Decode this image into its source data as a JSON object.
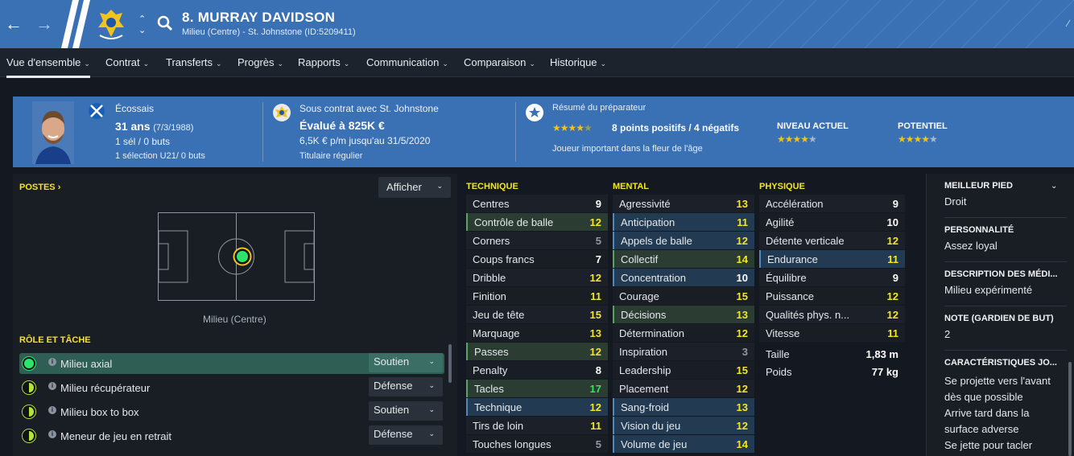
{
  "header": {
    "title": "8. MURRAY DAVIDSON",
    "subtitle": "Milieu (Centre) - St. Johnstone (ID:5209411)"
  },
  "menu": [
    {
      "label": "Vue d'ensemble"
    },
    {
      "label": "Contrat"
    },
    {
      "label": "Transferts"
    },
    {
      "label": "Progrès"
    },
    {
      "label": "Rapports"
    },
    {
      "label": "Communication"
    },
    {
      "label": "Comparaison"
    },
    {
      "label": "Historique"
    }
  ],
  "profile": {
    "nationality": "Écossais",
    "age": "31 ans",
    "dob": "(7/3/1988)",
    "caps": "1 sél / 0 buts",
    "u21": "1 sélection U21/ 0 buts",
    "contract": "Sous contrat avec St. Johnstone",
    "value": "Évalué à 825K €",
    "wage": "6,5K € p/m jusqu'au 31/5/2020",
    "status": "Titulaire régulier",
    "scout_title": "Résumé du préparateur",
    "scout_stars": 4,
    "scout_points": "8 points positifs / 4 négatifs",
    "scout_desc": "Joueur important dans la fleur de l'âge",
    "current_label": "NIVEAU ACTUEL",
    "current_stars": 4,
    "potential_label": "POTENTIEL",
    "potential_stars": 4
  },
  "positions": {
    "heading": "POSTES",
    "show_button": "Afficher",
    "position_label": "Milieu (Centre)"
  },
  "roles": {
    "heading": "RÔLE ET TÂCHE",
    "items": [
      {
        "name": "Milieu axial",
        "duty": "Soutien",
        "rating": "full"
      },
      {
        "name": "Milieu récupérateur",
        "duty": "Défense",
        "rating": "half"
      },
      {
        "name": "Milieu box to box",
        "duty": "Soutien",
        "rating": "half"
      },
      {
        "name": "Meneur de jeu en retrait",
        "duty": "Défense",
        "rating": "half"
      }
    ]
  },
  "technique": {
    "heading": "TECHNIQUE",
    "rows": [
      {
        "name": "Centres",
        "value": "9",
        "hl": "",
        "c": "w"
      },
      {
        "name": "Contrôle de balle",
        "value": "12",
        "hl": "g",
        "c": "yl"
      },
      {
        "name": "Corners",
        "value": "5",
        "hl": "",
        "c": "dim"
      },
      {
        "name": "Coups francs",
        "value": "7",
        "hl": "",
        "c": "w"
      },
      {
        "name": "Dribble",
        "value": "12",
        "hl": "",
        "c": "yl"
      },
      {
        "name": "Finition",
        "value": "11",
        "hl": "",
        "c": "yl"
      },
      {
        "name": "Jeu de tête",
        "value": "15",
        "hl": "",
        "c": "yl"
      },
      {
        "name": "Marquage",
        "value": "13",
        "hl": "",
        "c": "yl"
      },
      {
        "name": "Passes",
        "value": "12",
        "hl": "g",
        "c": "yl"
      },
      {
        "name": "Penalty",
        "value": "8",
        "hl": "",
        "c": "w"
      },
      {
        "name": "Tacles",
        "value": "17",
        "hl": "g",
        "c": "gr"
      },
      {
        "name": "Technique",
        "value": "12",
        "hl": "b",
        "c": "yl"
      },
      {
        "name": "Tirs de loin",
        "value": "11",
        "hl": "",
        "c": "yl"
      },
      {
        "name": "Touches longues",
        "value": "5",
        "hl": "",
        "c": "dim"
      }
    ]
  },
  "mental": {
    "heading": "MENTAL",
    "rows": [
      {
        "name": "Agressivité",
        "value": "13",
        "hl": "",
        "c": "yl"
      },
      {
        "name": "Anticipation",
        "value": "11",
        "hl": "b",
        "c": "yl"
      },
      {
        "name": "Appels de balle",
        "value": "12",
        "hl": "b",
        "c": "yl"
      },
      {
        "name": "Collectif",
        "value": "14",
        "hl": "g",
        "c": "yl"
      },
      {
        "name": "Concentration",
        "value": "10",
        "hl": "b",
        "c": "w"
      },
      {
        "name": "Courage",
        "value": "15",
        "hl": "",
        "c": "yl"
      },
      {
        "name": "Décisions",
        "value": "13",
        "hl": "g",
        "c": "yl"
      },
      {
        "name": "Détermination",
        "value": "12",
        "hl": "",
        "c": "yl"
      },
      {
        "name": "Inspiration",
        "value": "3",
        "hl": "",
        "c": "dim"
      },
      {
        "name": "Leadership",
        "value": "15",
        "hl": "",
        "c": "yl"
      },
      {
        "name": "Placement",
        "value": "12",
        "hl": "",
        "c": "yl"
      },
      {
        "name": "Sang-froid",
        "value": "13",
        "hl": "b",
        "c": "yl"
      },
      {
        "name": "Vision du jeu",
        "value": "12",
        "hl": "b",
        "c": "yl"
      },
      {
        "name": "Volume de jeu",
        "value": "14",
        "hl": "b",
        "c": "yl"
      }
    ]
  },
  "physique": {
    "heading": "PHYSIQUE",
    "rows": [
      {
        "name": "Accélération",
        "value": "9",
        "hl": "",
        "c": "w"
      },
      {
        "name": "Agilité",
        "value": "10",
        "hl": "",
        "c": "w"
      },
      {
        "name": "Détente verticale",
        "value": "12",
        "hl": "",
        "c": "yl"
      },
      {
        "name": "Endurance",
        "value": "11",
        "hl": "b",
        "c": "yl"
      },
      {
        "name": "Équilibre",
        "value": "9",
        "hl": "",
        "c": "w"
      },
      {
        "name": "Puissance",
        "value": "12",
        "hl": "",
        "c": "yl"
      },
      {
        "name": "Qualités phys. n...",
        "value": "12",
        "hl": "",
        "c": "yl"
      },
      {
        "name": "Vitesse",
        "value": "11",
        "hl": "",
        "c": "yl"
      }
    ],
    "height_label": "Taille",
    "height": "1,83 m",
    "weight_label": "Poids",
    "weight": "77 kg"
  },
  "sidebar": {
    "foot_label": "MEILLEUR PIED",
    "foot": "Droit",
    "personality_label": "PERSONNALITÉ",
    "personality": "Assez loyal",
    "media_label": "DESCRIPTION DES MÉDI...",
    "media": "Milieu expérimenté",
    "gk_label": "NOTE (GARDIEN DE BUT)",
    "gk": "2",
    "traits_label": "CARACTÉRISTIQUES JO...",
    "traits": [
      "Se projette vers l'avant dès que possible",
      "Arrive tard dans la surface adverse",
      "Se jette pour tacler"
    ]
  }
}
